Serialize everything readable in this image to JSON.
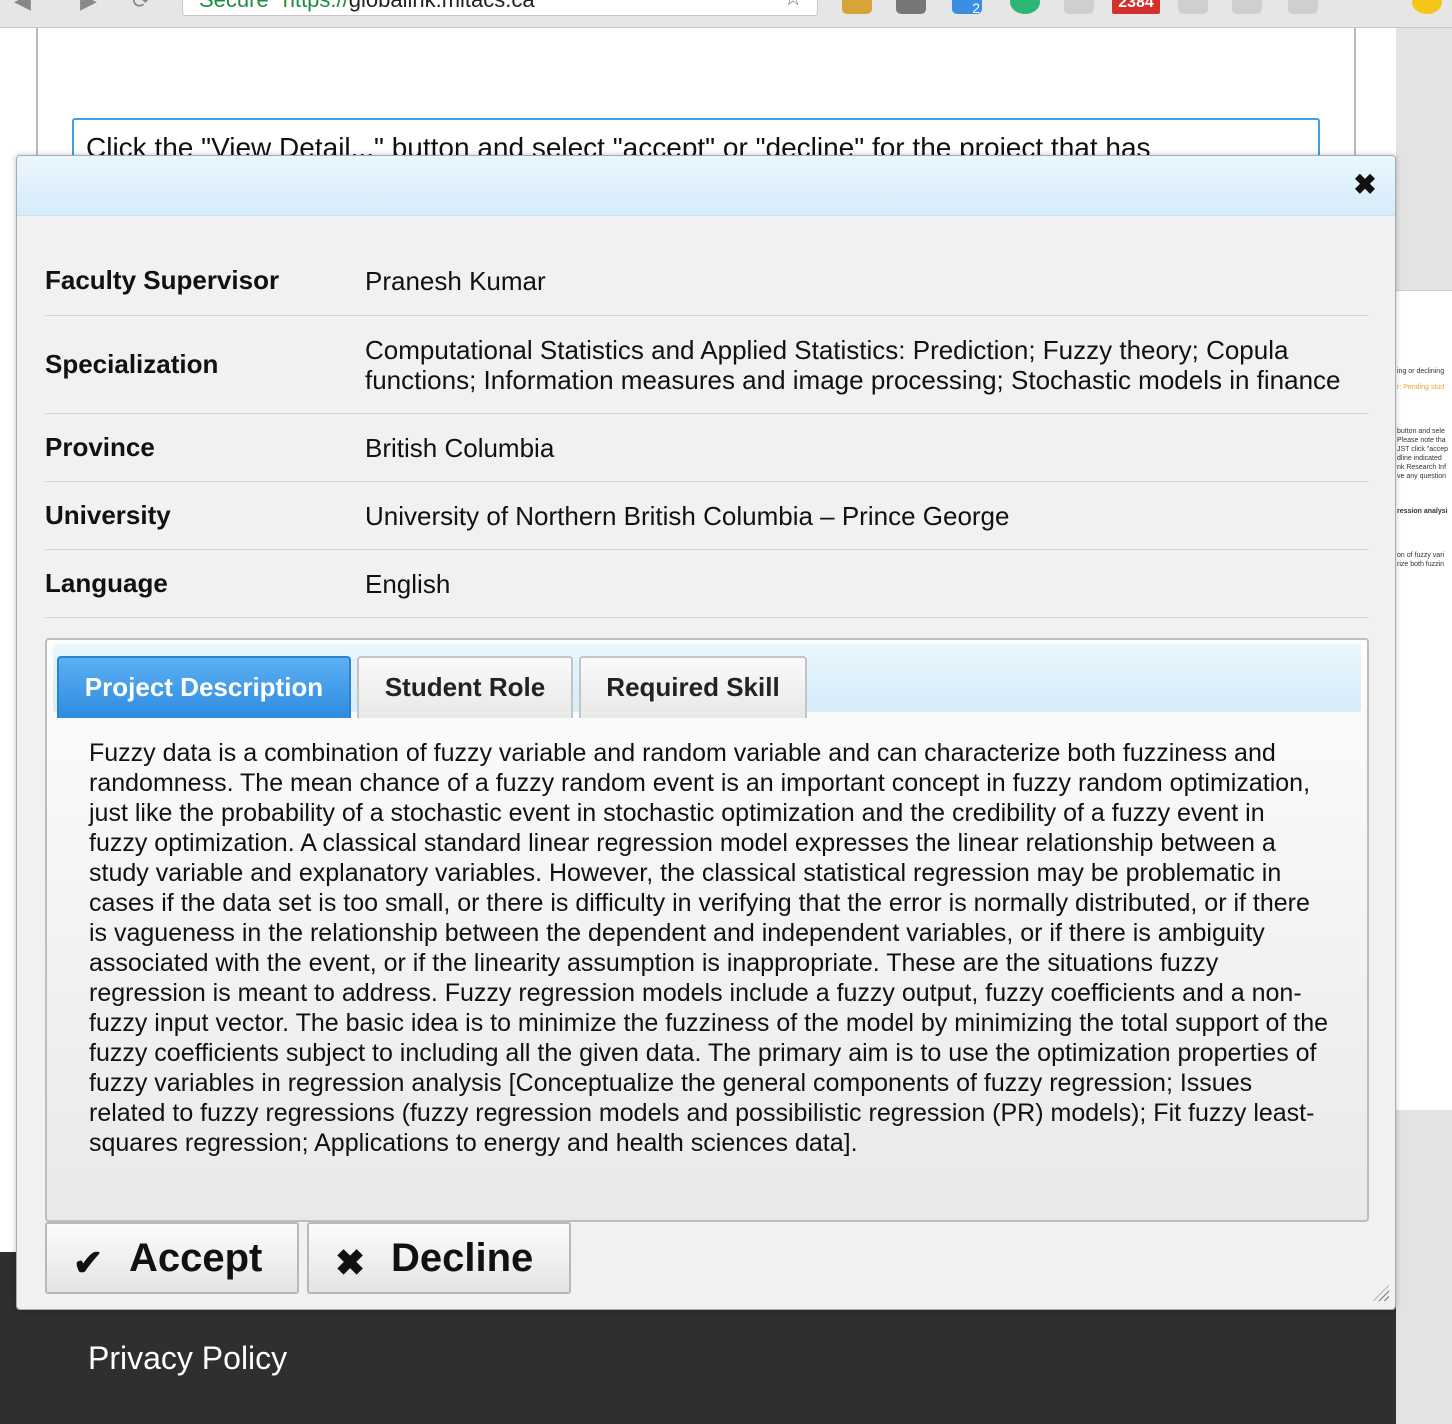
{
  "browser": {
    "secure_label": "Secure",
    "url_protocol": "https://",
    "url_host": "globalink.mitacs.ca",
    "extension_badge_count": "2384",
    "extension_small_badge": "2"
  },
  "page": {
    "instruction_text": "Click the \"View Detail...\" button and select \"accept\" or \"decline\" for the project that has",
    "side_snippets": [
      "ing or declining",
      "r: Pending stud",
      "button and sele",
      "Please note tha",
      "JST click \"accep",
      "dline indicated",
      "nk Research Inf",
      "ve any question",
      "ression analysi",
      "on of fuzzy vari",
      "rize both fuzzin"
    ],
    "footer_link": "Privacy Policy"
  },
  "dialog": {
    "close_glyph": "✖",
    "fields": [
      {
        "label": "Faculty Supervisor",
        "value": "Pranesh Kumar"
      },
      {
        "label": "Specialization",
        "value": "Computational Statistics and Applied Statistics: Prediction; Fuzzy theory; Copula functions; Information measures and image processing; Stochastic models in finance"
      },
      {
        "label": "Province",
        "value": "British Columbia"
      },
      {
        "label": "University",
        "value": "University of Northern British Columbia – Prince George"
      },
      {
        "label": "Language",
        "value": "English"
      }
    ],
    "tabs": [
      {
        "label": "Project Description",
        "active": true
      },
      {
        "label": "Student Role",
        "active": false
      },
      {
        "label": "Required Skill",
        "active": false
      }
    ],
    "project_description": "Fuzzy data is a combination of fuzzy variable and random variable and can characterize both fuzziness and randomness. The mean chance of a fuzzy random event is an important concept in fuzzy random optimization, just like the probability of a stochastic event in stochastic optimization and the credibility of a fuzzy event in fuzzy optimization. A classical standard linear regression model expresses the linear relationship between a study variable and explanatory variables. However, the classical statistical regression may be problematic in cases if the data set is too small, or there is difficulty in verifying that the error is normally distributed, or if there is vagueness in the relationship between the dependent and independent variables, or if there is ambiguity associated with the event, or if the linearity assumption is inappropriate. These are the situations fuzzy regression is meant to address. Fuzzy regression models include a fuzzy output, fuzzy coefficients and a non-fuzzy input vector. The basic idea is to minimize the fuzziness of the model by minimizing the total support of the fuzzy coefficients subject to including all the given data. The primary aim is to use the optimization properties of fuzzy variables in regression analysis [Conceptualize the general components of fuzzy regression; Issues related to fuzzy regressions (fuzzy regression models and possibilistic regression (PR) models); Fit fuzzy least-squares regression; Applications to energy and health sciences data].",
    "accept": {
      "label": "Accept",
      "icon": "✔"
    },
    "decline": {
      "label": "Decline",
      "icon": "✖"
    }
  },
  "colors": {
    "active_tab": "#3a96e6",
    "titlebar": "#d5ecfa",
    "footer": "#2f2f2f",
    "instruction_border": "#3aa3e3"
  }
}
